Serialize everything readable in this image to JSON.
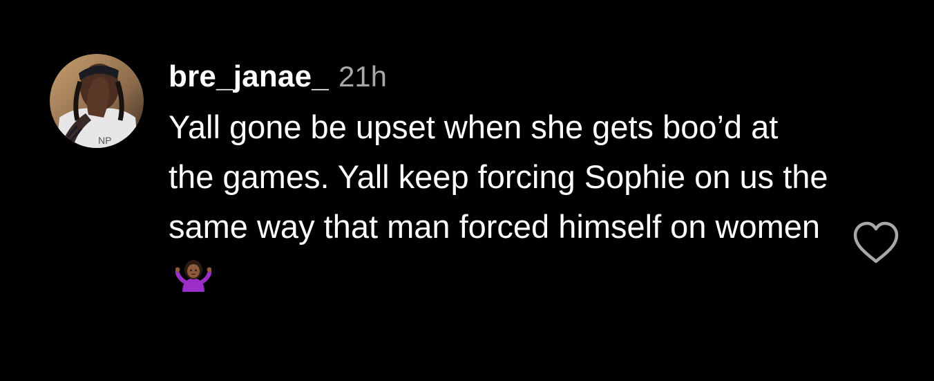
{
  "comment": {
    "username": "bre_janae_",
    "timestamp": "21h",
    "text": "Yall gone be upset when she gets boo’d at the games. Yall keep forcing Sophie on us the same way that man forced himself on women",
    "emoji": "person-shrugging-emoji"
  },
  "colors": {
    "background": "#000000",
    "text": "#ffffff",
    "muted": "#a8a8a8"
  },
  "icons": {
    "like": "heart-outline-icon"
  }
}
